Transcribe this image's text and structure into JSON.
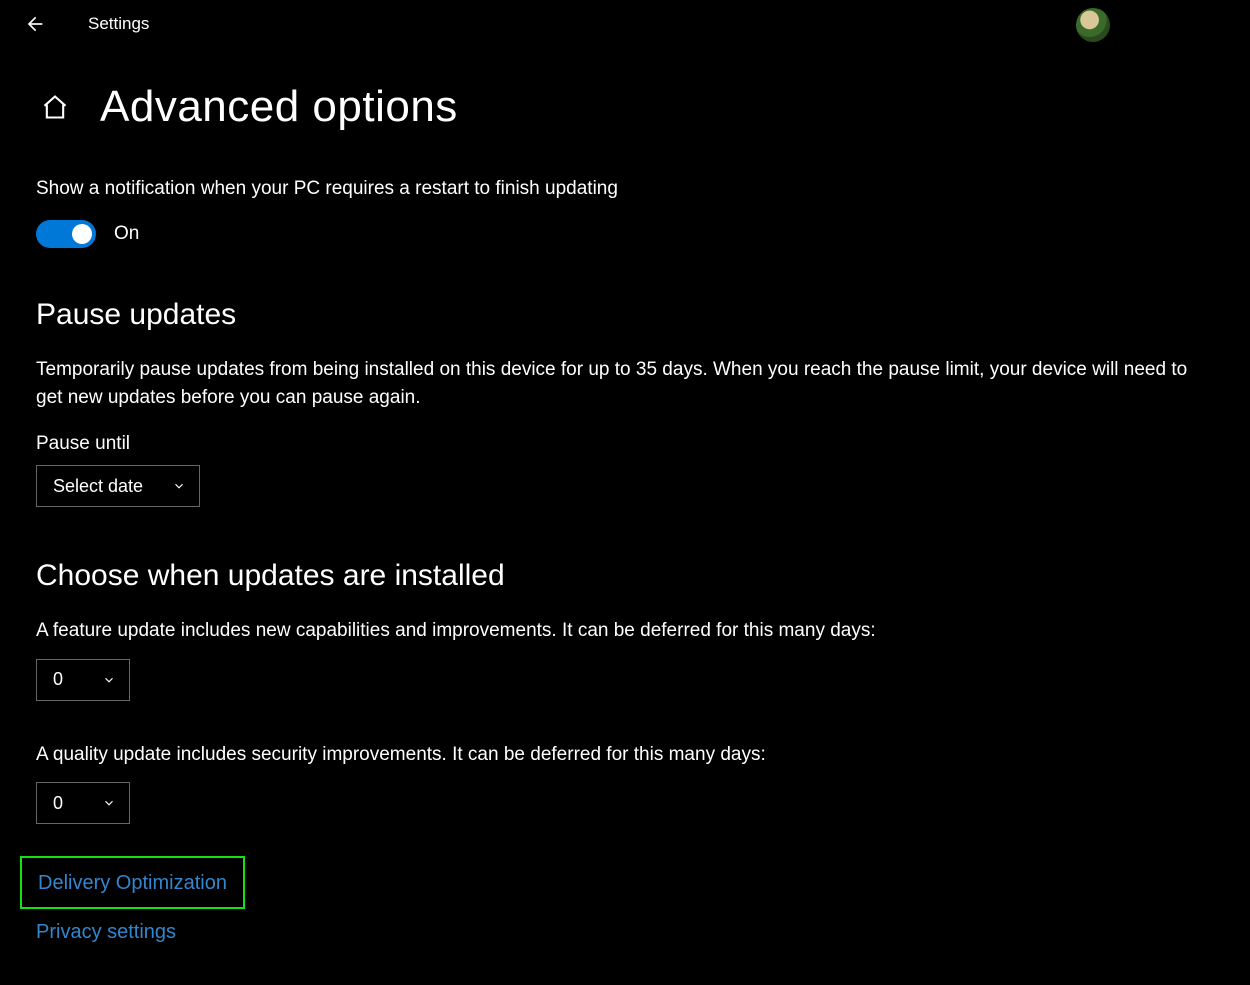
{
  "titlebar": {
    "app_title": "Settings"
  },
  "page": {
    "title": "Advanced options"
  },
  "restart_notify": {
    "label": "Show a notification when your PC requires a restart to finish updating",
    "toggle_state": "On"
  },
  "pause_updates": {
    "heading": "Pause updates",
    "description": "Temporarily pause updates from being installed on this device for up to 35 days. When you reach the pause limit, your device will need to get new updates before you can pause again.",
    "field_label": "Pause until",
    "dropdown_value": "Select date"
  },
  "choose_when": {
    "heading": "Choose when updates are installed",
    "feature_label": "A feature update includes new capabilities and improvements. It can be deferred for this many days:",
    "feature_value": "0",
    "quality_label": "A quality update includes security improvements. It can be deferred for this many days:",
    "quality_value": "0"
  },
  "links": {
    "delivery_optimization": "Delivery Optimization",
    "privacy_settings": "Privacy settings"
  }
}
